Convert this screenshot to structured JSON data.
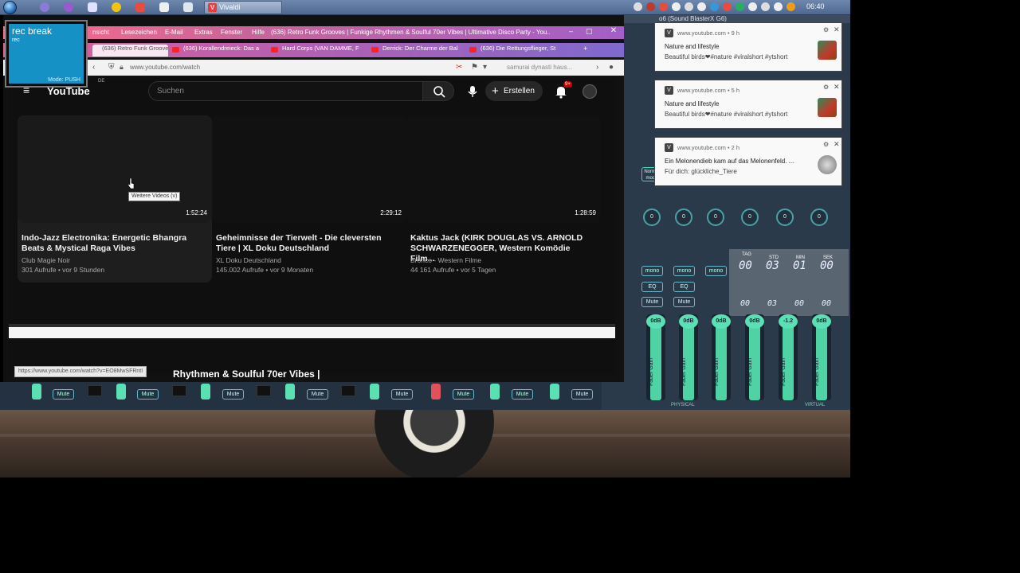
{
  "taskbar": {
    "active_app": "Vivaldi",
    "clock": "06:40"
  },
  "rec_widget": {
    "title": "rec break",
    "subtitle": "rec",
    "mode": "Mode: PUSH"
  },
  "browser": {
    "menu": [
      "nsicht",
      "Lesezeichen",
      "E-Mail",
      "Extras",
      "Fenster",
      "Hilfe"
    ],
    "window_title": "(636) Retro Funk Grooves | Funkige Rhythmen & Soulful 70er Vibes | Ultimative Disco Party - You...",
    "close_label": "✕",
    "tabs": [
      {
        "label": "(636) Retro Funk Grooves | F"
      },
      {
        "label": "(636) Korallendreieck: Das a"
      },
      {
        "label": "Hard Corps (VAN DAMME, F"
      },
      {
        "label": "Derrick: Der Charme der Bal"
      },
      {
        "label": "(636) Die Rettungsflieger, St"
      }
    ],
    "url": "www.youtube.com/watch",
    "search_text": "samurai dynasti  haus..."
  },
  "youtube": {
    "logo": "YouTube",
    "region": "DE",
    "search_placeholder": "Suchen",
    "create_label": "Erstellen",
    "notification_badge": "9+",
    "tooltip": "Weitere Videos (v)",
    "videos": [
      {
        "title": "Indo-Jazz Electronika: Energetic Bhangra Beats & Mystical Raga Vibes",
        "channel": "Club Magie Noir",
        "meta": "301 Aufrufe • vor 9 Stunden",
        "duration": "1:52:24"
      },
      {
        "title": "Geheimnisse der Tierwelt - Die cleversten Tiere | XL Doku Deutschland",
        "channel": "XL Doku Deutschland",
        "meta": "145.002 Aufrufe • vor 9 Monaten",
        "duration": "2:29:12"
      },
      {
        "title": "Kaktus Jack (KIRK DOUGLAS VS. ARNOLD SCHWARZENEGGER, Western Komödie Film...",
        "channel": "Bronco - Western Filme",
        "meta": "44 161 Aufrufe • vor 5 Tagen",
        "duration": "1:28:59"
      }
    ],
    "below_title": "Rhythmen & Soulful 70er Vibes |",
    "status_url": "https://www.youtube.com/watch?v=EO8MwSFRntI"
  },
  "notifications": [
    {
      "source": "www.youtube.com",
      "age": "9 h",
      "title": "Nature and lifestyle",
      "body": "Beautiful birds❤#nature #viralshort #ytshort"
    },
    {
      "source": "www.youtube.com",
      "age": "5 h",
      "title": "Nature and lifestyle",
      "body": "Beautiful birds❤#nature #viralshort #ytshort"
    },
    {
      "source": "www.youtube.com",
      "age": "2 h",
      "title": "Ein Melonendieb kam auf das Melonenfeld. ...",
      "body": "Für dich: glückliche_Tiere"
    }
  ],
  "voicemeeter": {
    "device": "o6 (Sound BlasterX G6)",
    "mode_label": "Normal mode",
    "knob_value": "0",
    "mono_label": "mono",
    "eq_label": "EQ",
    "mute_label": "Mute",
    "fader_label": "Fader Gain",
    "fader_values": [
      "0dB",
      "0dB",
      "0dB",
      "0dB",
      "0dB",
      "-1.2",
      "0dB"
    ],
    "recorder": {
      "labels": [
        "TAG",
        "STD",
        "MIN",
        "SEK"
      ],
      "row1": [
        "00",
        "03",
        "01",
        "00"
      ],
      "row2": [
        "00",
        "03",
        "00",
        "00"
      ]
    },
    "physical": "PHYSICAL",
    "virtual": "VIRTUAL"
  },
  "colors": {
    "accent_green": "#4fd3a5",
    "youtube_red": "#ff0000",
    "vivaldi_red": "#ef3939"
  }
}
